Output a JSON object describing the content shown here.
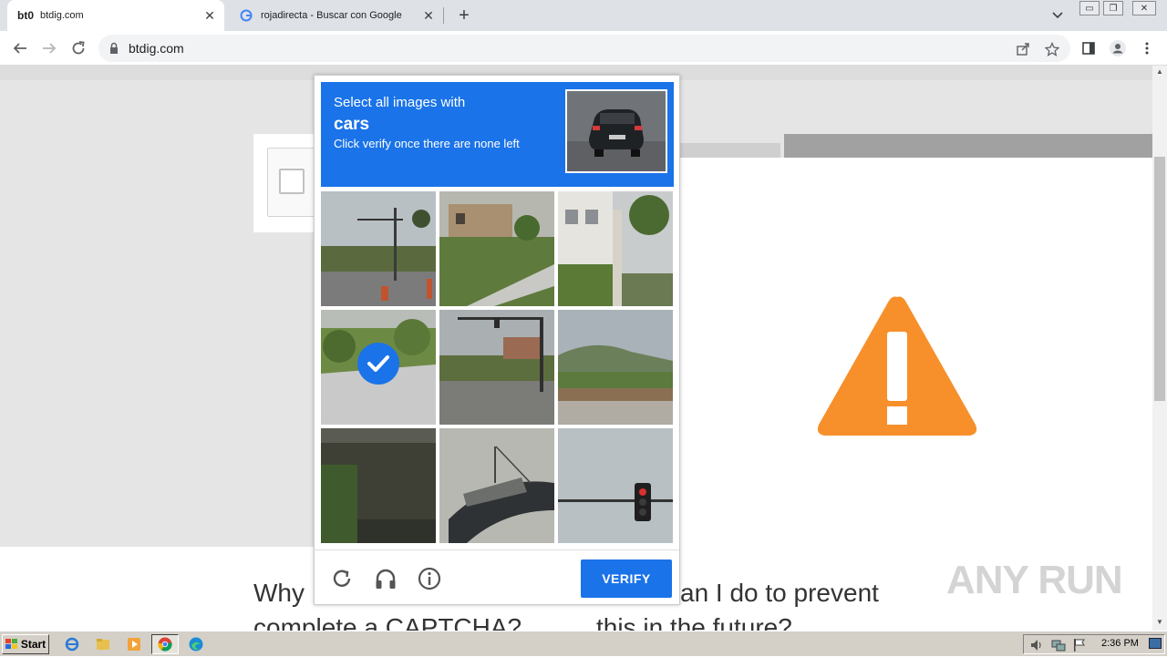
{
  "browser": {
    "tabs": [
      {
        "favicon_text": "bt0",
        "title": "btdig.com",
        "close": "✕"
      },
      {
        "favicon_text": "G",
        "title": "rojadirecta - Buscar con Google",
        "close": "✕"
      }
    ],
    "new_tab": "+",
    "url": "btdig.com"
  },
  "page": {
    "question_left": [
      "Why",
      "complete a CAPTCHA?"
    ],
    "question_right": [
      "can I do to prevent",
      "this in the future?"
    ]
  },
  "captcha": {
    "instruction_line1": "Select all images with",
    "target": "cars",
    "instruction_line3": "Click verify once there are none left",
    "verify_label": "VERIFY",
    "tiles": [
      {
        "name": "tile-1",
        "selected": false
      },
      {
        "name": "tile-2",
        "selected": false
      },
      {
        "name": "tile-3",
        "selected": false
      },
      {
        "name": "tile-4",
        "selected": true
      },
      {
        "name": "tile-5",
        "selected": false
      },
      {
        "name": "tile-6",
        "selected": false
      },
      {
        "name": "tile-7",
        "selected": false
      },
      {
        "name": "tile-8",
        "selected": false
      },
      {
        "name": "tile-9",
        "selected": false
      }
    ]
  },
  "watermark": "ANY RUN",
  "taskbar": {
    "start_label": "Start",
    "clock": "2:36 PM"
  },
  "colors": {
    "captcha_blue": "#1a73e8",
    "warning_orange": "#f7902b"
  }
}
